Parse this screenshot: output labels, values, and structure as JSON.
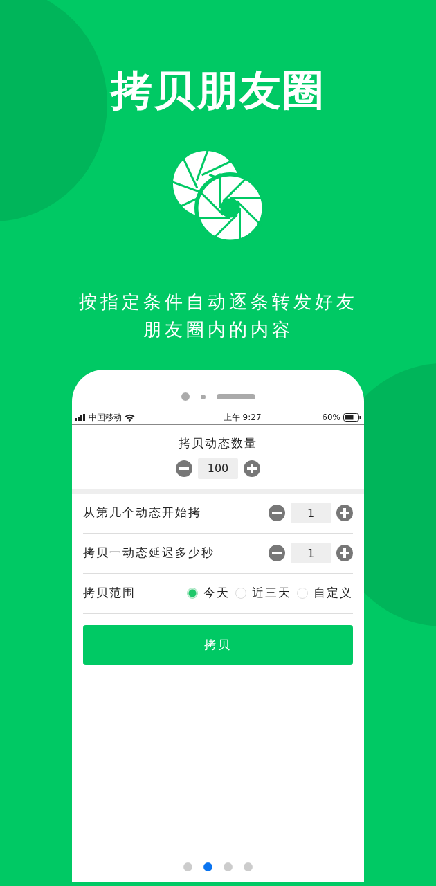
{
  "title": "拷贝朋友圈",
  "subtitle": [
    "按指定条件自动逐条转发好友",
    "朋友圈内的内容"
  ],
  "status_bar": {
    "carrier": "中国移动",
    "time": "上午 9:27",
    "battery": "60%"
  },
  "count": {
    "label": "拷贝动态数量",
    "value": "100"
  },
  "settings": [
    {
      "kind": "stepper",
      "label": "从第几个动态开始拷",
      "value": "1"
    },
    {
      "kind": "stepper",
      "label": "拷贝一动态延迟多少秒",
      "value": "1"
    },
    {
      "kind": "radio",
      "label": "拷贝范围",
      "options": [
        {
          "label": "今天",
          "selected": true
        },
        {
          "label": "近三天",
          "selected": false
        },
        {
          "label": "自定义",
          "selected": false
        }
      ]
    }
  ],
  "copy_button": "拷贝",
  "pages": [
    {
      "selected": false
    },
    {
      "selected": true
    },
    {
      "selected": false
    },
    {
      "selected": false
    }
  ]
}
